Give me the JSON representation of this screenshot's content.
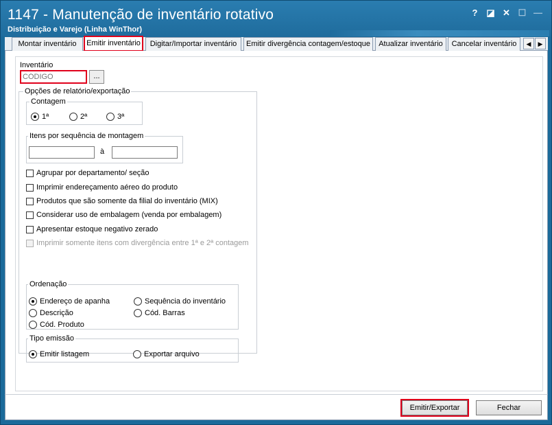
{
  "window": {
    "title": "1147 - Manutenção de inventário rotativo",
    "subtitle": "Distribuição e Varejo (Linha WinThor)",
    "controls": {
      "help": "?",
      "restore_glyph": "◪",
      "close": "✕",
      "maximize": "☐",
      "minimize": "—"
    }
  },
  "tabs": [
    {
      "label": "Montar inventário"
    },
    {
      "label": "Emitir inventário"
    },
    {
      "label": "Digitar/Importar inventário"
    },
    {
      "label": "Emitir divergência contagem/estoque"
    },
    {
      "label": "Atualizar inventário"
    },
    {
      "label": "Cancelar inventário"
    }
  ],
  "tabnav": {
    "prev": "◀",
    "next": "▶"
  },
  "inventario": {
    "label": "Inventário",
    "placeholder": "CÓDIGO",
    "browse_label": "..."
  },
  "opcoes": {
    "title": "Opções de relatório/exportação",
    "contagem": {
      "title": "Contagem",
      "options": [
        "1ª",
        "2ª",
        "3ª"
      ],
      "selected": "1ª"
    },
    "itens": {
      "title": "Itens por sequência de montagem",
      "separator": "à",
      "from": "",
      "to": ""
    },
    "checks": [
      {
        "label": "Agrupar por departamento/ seção",
        "checked": false,
        "enabled": true
      },
      {
        "label": "Imprimir endereçamento aéreo do produto",
        "checked": false,
        "enabled": true
      },
      {
        "label": "Produtos que são somente da filial do inventário (MIX)",
        "checked": false,
        "enabled": true
      },
      {
        "label": "Considerar uso de embalagem (venda por embalagem)",
        "checked": false,
        "enabled": true
      },
      {
        "label": "Apresentar estoque negativo zerado",
        "checked": false,
        "enabled": true
      },
      {
        "label": "Imprimir somente itens com divergência entre 1ª e 2ª contagem",
        "checked": false,
        "enabled": false
      }
    ],
    "ordenacao": {
      "title": "Ordenação",
      "options": [
        "Endereço de apanha",
        "Sequência do inventário",
        "Descrição",
        "Cód. Barras",
        "Cód. Produto"
      ],
      "selected": "Endereço de apanha"
    },
    "tipo_emissao": {
      "title": "Tipo emissão",
      "options": [
        "Emitir listagem",
        "Exportar arquivo"
      ],
      "selected": "Emitir listagem"
    }
  },
  "footer": {
    "emitir_label": "Emitir/Exportar",
    "fechar_label": "Fechar"
  },
  "colors": {
    "titlebar": "#1f6c9d",
    "highlight": "#e0001b"
  }
}
